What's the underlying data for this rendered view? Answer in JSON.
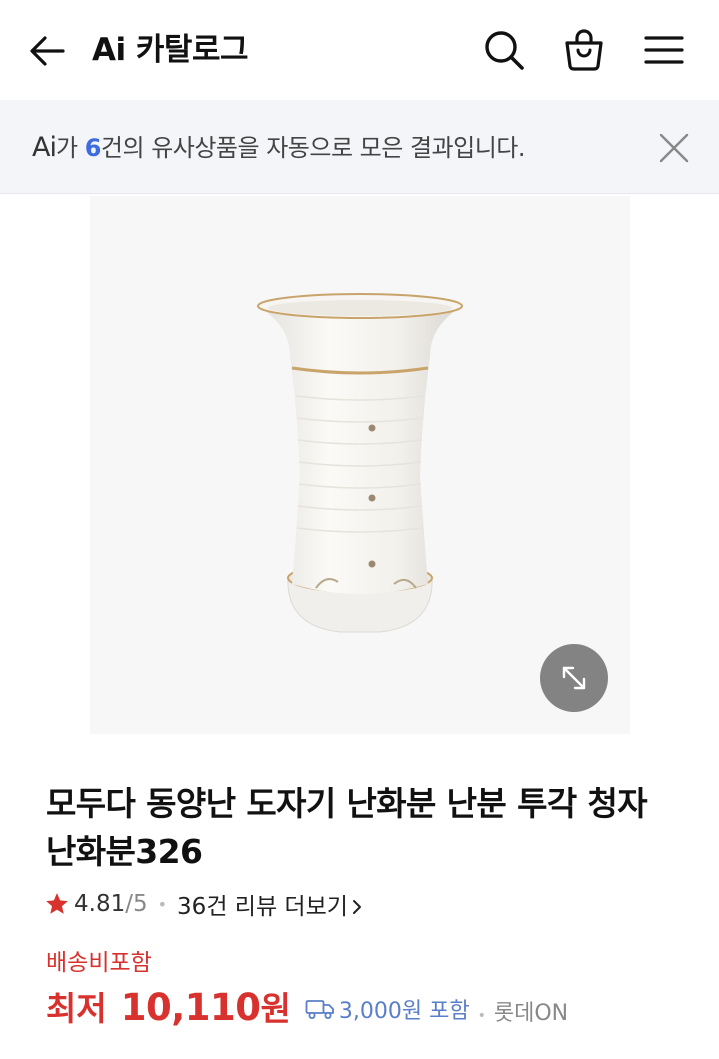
{
  "header": {
    "back_icon": "arrow-left-icon",
    "title": "Ai 카탈로그",
    "search_icon": "search-icon",
    "cart_icon": "shopping-bag-icon",
    "menu_icon": "hamburger-menu-icon"
  },
  "notice": {
    "logo": "Ai",
    "text_before": "가 ",
    "count": "6",
    "text_after": "건의 유사상품을 자동으로 모은 결과입니다.",
    "close_icon": "close-icon"
  },
  "product": {
    "image_alt": "white ceramic orchid pot",
    "zoom_icon": "expand-arrows-icon",
    "name": "모두다 동양난 도자기 난화분 난분 투각 청자 난화분326",
    "rating": "4.81",
    "rating_max": "/5",
    "review_link": "36건 리뷰 더보기",
    "shipping_label": "배송비포함",
    "price_prefix": "최저",
    "price_value": "10,110",
    "price_unit": "원",
    "delivery_fee": "3,000원 포함",
    "seller": "롯데ON"
  },
  "colors": {
    "price_red": "#d8322f",
    "accent_blue": "#3d6be0",
    "notice_bg": "#f3f5f8"
  }
}
